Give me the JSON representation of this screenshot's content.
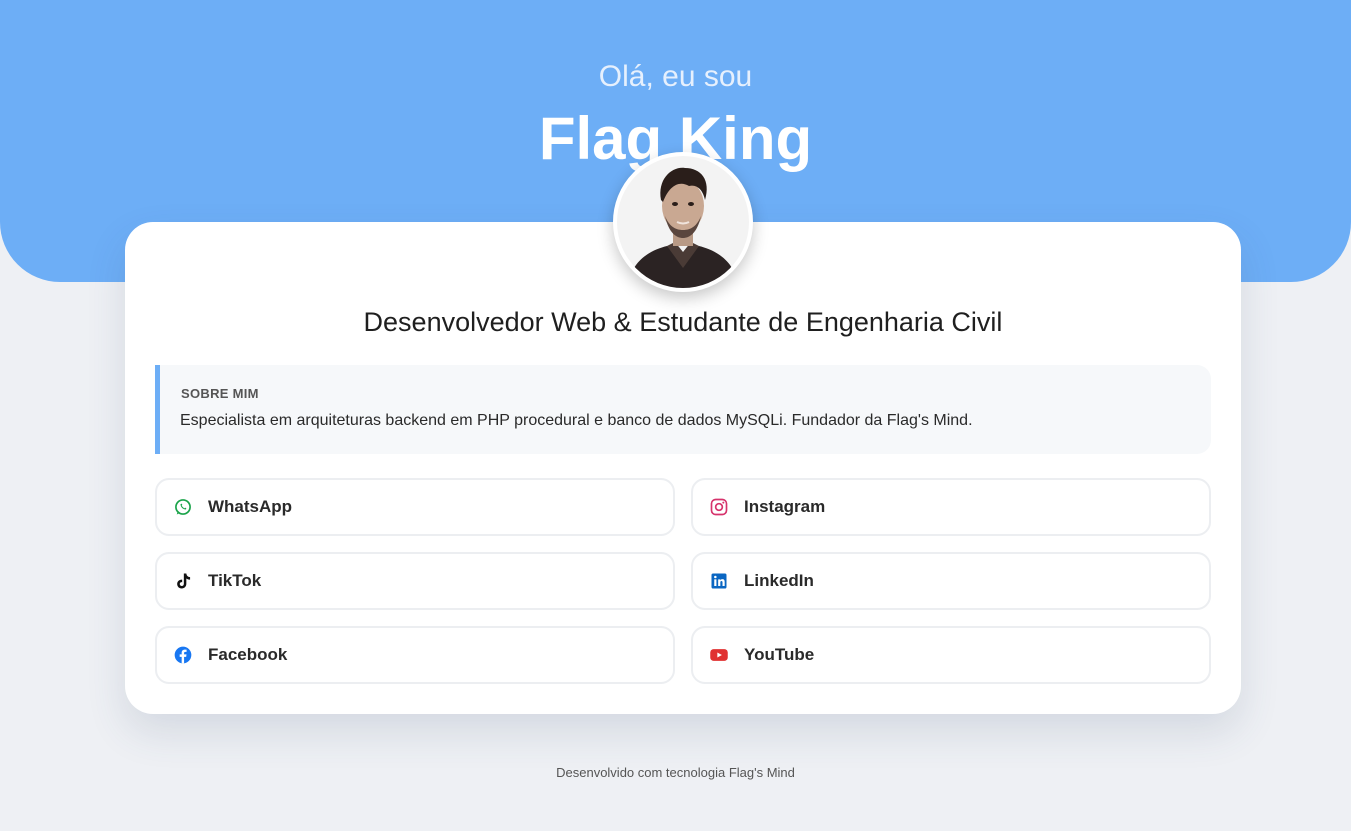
{
  "hero": {
    "greeting": "Olá, eu sou",
    "name": "Flag King"
  },
  "profile": {
    "avatar_icon": "profile-photo",
    "role": "Desenvolvedor Web & Estudante de Engenharia Civil"
  },
  "about": {
    "title": "SOBRE MIM",
    "text": "Especialista em arquiteturas backend em PHP procedural e banco de dados MySQLi. Fundador da Flag's Mind."
  },
  "links": [
    {
      "label": "WhatsApp",
      "icon": "whatsapp-icon",
      "color": "#1aa34a"
    },
    {
      "label": "Instagram",
      "icon": "instagram-icon",
      "color": "#d6336c"
    },
    {
      "label": "TikTok",
      "icon": "tiktok-icon",
      "color": "#111111"
    },
    {
      "label": "LinkedIn",
      "icon": "linkedin-icon",
      "color": "#0a66c2"
    },
    {
      "label": "Facebook",
      "icon": "facebook-icon",
      "color": "#1877f2"
    },
    {
      "label": "YouTube",
      "icon": "youtube-icon",
      "color": "#e03131"
    }
  ],
  "footer": {
    "text": "Desenvolvido com tecnologia Flag's Mind"
  },
  "colors": {
    "accent": "#6daef6",
    "background": "#eef0f4",
    "card": "#ffffff"
  }
}
